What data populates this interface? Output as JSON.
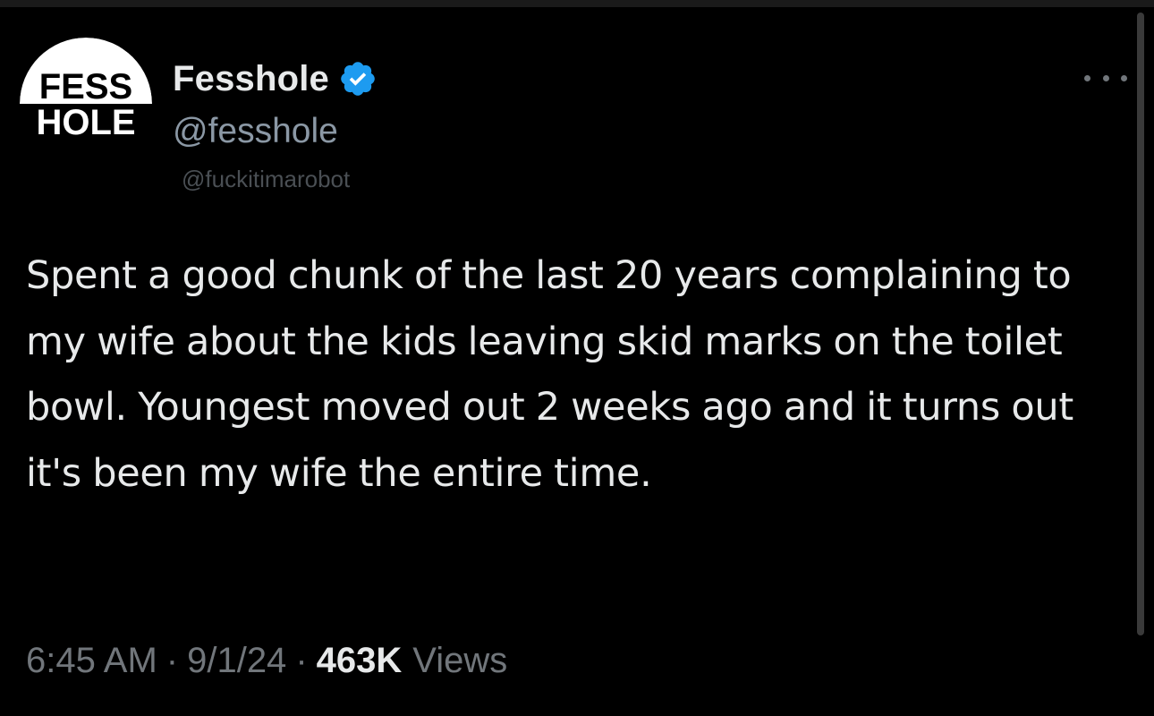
{
  "tweet": {
    "avatar": {
      "line1": "FESS",
      "line2": "HOLE"
    },
    "display_name": "Fesshole",
    "verified_icon": "verified-badge-icon",
    "handle": "@fesshole",
    "watermark": "@fuckitimarobot",
    "more_icon": "more-options-icon",
    "text": "Spent a good chunk of the last 20 years complaining to my wife about the kids leaving skid marks on the toilet bowl. Youngest moved out 2 weeks ago and it turns out it's been my wife the entire time.",
    "time": "6:45 AM",
    "date": "9/1/24",
    "separator": "·",
    "views_count": "463K",
    "views_label": "Views"
  },
  "colors": {
    "background": "#000000",
    "text_primary": "#e7e9ea",
    "text_secondary": "#71767b",
    "verified_blue": "#1d9bf0"
  }
}
